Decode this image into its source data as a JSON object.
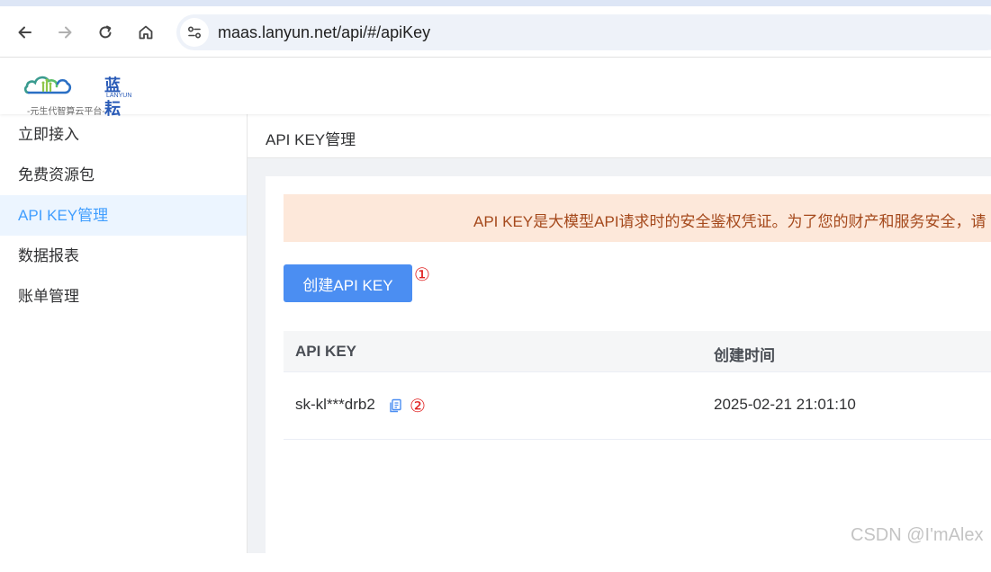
{
  "browser": {
    "url": "maas.lanyun.net/api/#/apiKey"
  },
  "brand": {
    "name": "蓝耘",
    "name_en": "LANYUN",
    "tagline": "-元生代智算云平台-"
  },
  "sidebar": {
    "items": [
      {
        "label": "立即接入",
        "active": false
      },
      {
        "label": "免费资源包",
        "active": false
      },
      {
        "label": "API KEY管理",
        "active": true
      },
      {
        "label": "数据报表",
        "active": false
      },
      {
        "label": "账单管理",
        "active": false
      }
    ]
  },
  "page": {
    "title": "API KEY管理",
    "notice": "API KEY是大模型API请求时的安全鉴权凭证。为了您的财产和服务安全，请",
    "create_button": "创建API KEY",
    "marker_1": "①",
    "marker_2": "②"
  },
  "table": {
    "columns": [
      "API KEY",
      "创建时间"
    ],
    "rows": [
      {
        "api_key": "sk-kl***drb2",
        "created_at": "2025-02-21 21:01:10"
      }
    ]
  },
  "watermark": "CSDN @I'mAlex",
  "colors": {
    "accent": "#409eff",
    "button": "#4b8ef2",
    "notice_bg": "#fde8da",
    "notice_text": "#a5491c",
    "marker": "#e02020"
  }
}
